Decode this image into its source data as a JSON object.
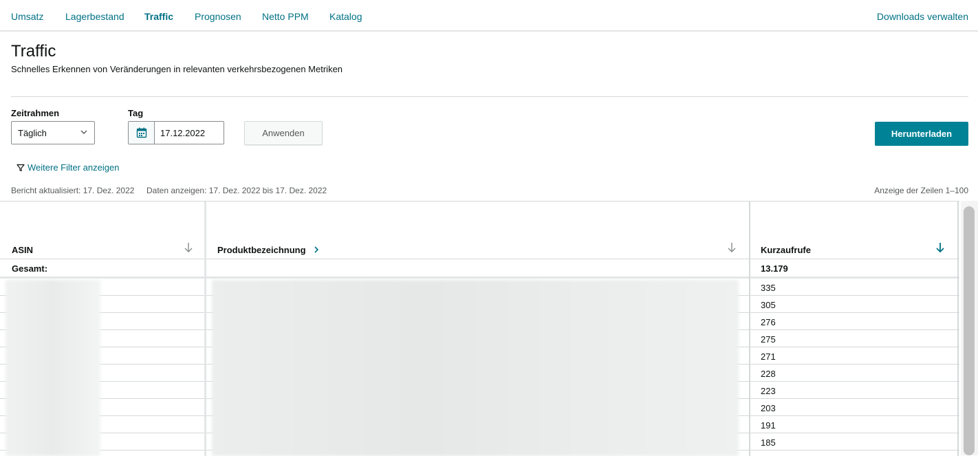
{
  "nav": {
    "tabs": [
      {
        "label": "Umsatz"
      },
      {
        "label": "Lagerbestand"
      },
      {
        "label": "Traffic"
      },
      {
        "label": "Prognosen"
      },
      {
        "label": "Netto PPM"
      },
      {
        "label": "Katalog"
      }
    ],
    "right_link": "Downloads verwalten"
  },
  "page": {
    "title": "Traffic",
    "subtitle": "Schnelles Erkennen von Veränderungen in relevanten verkehrsbezogenen Metriken"
  },
  "filters": {
    "zeitrahmen_label": "Zeitrahmen",
    "zeitrahmen_value": "Täglich",
    "tag_label": "Tag",
    "tag_value": "17.12.2022",
    "apply_label": "Anwenden",
    "download_label": "Herunterladen",
    "more_filters_label": "Weitere Filter anzeigen"
  },
  "meta": {
    "updated": "Bericht aktualisiert: 17. Dez. 2022",
    "range": "Daten anzeigen: 17. Dez. 2022 bis 17. Dez. 2022",
    "rows": "Anzeige der Zeilen 1–100"
  },
  "table": {
    "columns": [
      "ASIN",
      "Produktbezeichnung",
      "Kurzaufrufe"
    ],
    "total_label": "Gesamt:",
    "total_value": "13.179",
    "rows": [
      {
        "kurzaufrufe": "335"
      },
      {
        "kurzaufrufe": "305"
      },
      {
        "kurzaufrufe": "276"
      },
      {
        "kurzaufrufe": "275"
      },
      {
        "kurzaufrufe": "271"
      },
      {
        "kurzaufrufe": "228"
      },
      {
        "kurzaufrufe": "223"
      },
      {
        "kurzaufrufe": "203"
      },
      {
        "kurzaufrufe": "191"
      },
      {
        "kurzaufrufe": "185"
      }
    ]
  },
  "colors": {
    "link": "#007185",
    "primary_button": "#008296"
  }
}
